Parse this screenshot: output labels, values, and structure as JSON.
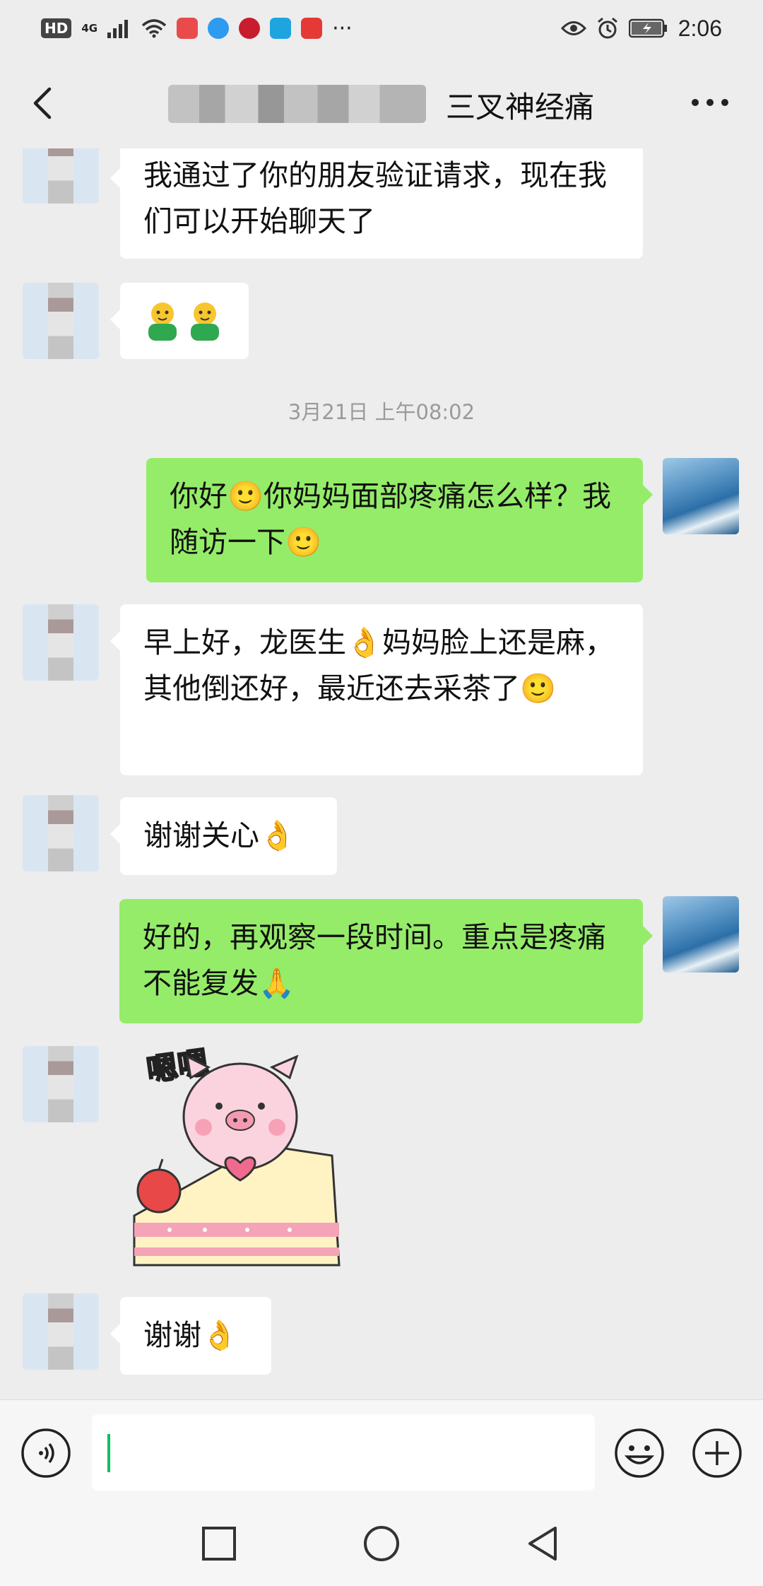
{
  "status_bar": {
    "hd": "HD",
    "network": "4G",
    "time": "2:06",
    "more": "···"
  },
  "header": {
    "title": "三叉神经痛",
    "back_icon": "chevron-left-icon",
    "more_icon": "more-dots-icon"
  },
  "messages": [
    {
      "side": "left",
      "text": "我通过了你的朋友验证请求，现在我们可以开始聊天了"
    },
    {
      "side": "left",
      "text": "🧑‍🤝‍🧑",
      "emoji": "two-people-emoji"
    },
    {
      "type": "timestamp",
      "text": "3月21日 上午08:02"
    },
    {
      "side": "right",
      "text": "你好🙂你妈妈面部疼痛怎么样？我随访一下🙂"
    },
    {
      "side": "left",
      "text": "早上好，龙医生👌妈妈脸上还是麻，其他倒还好，最近还去采茶了🙂"
    },
    {
      "side": "left",
      "text": "谢谢关心👌"
    },
    {
      "side": "right",
      "text": "好的，再观察一段时间。重点是疼痛不能复发🙏"
    },
    {
      "side": "left",
      "type": "sticker",
      "text": "嗯嗯",
      "sticker": "pink-pig-heart-cake-sticker"
    },
    {
      "side": "left",
      "text": "谢谢👌"
    }
  ],
  "input_bar": {
    "voice_icon": "voice-icon",
    "input_value": "",
    "emoji_icon": "emoji-icon",
    "plus_icon": "plus-icon"
  },
  "nav_bar": {
    "recent_icon": "square-icon",
    "home_icon": "circle-icon",
    "back_icon": "triangle-back-icon"
  },
  "colors": {
    "background": "#ededed",
    "bubble_green": "#95ec69",
    "bubble_white": "#ffffff",
    "cursor": "#07c160"
  }
}
